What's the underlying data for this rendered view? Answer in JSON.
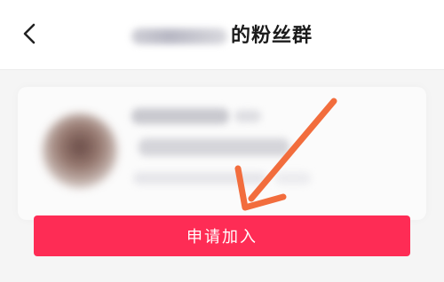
{
  "header": {
    "title_suffix": "的粉丝群",
    "back_icon": "chevron-left-icon"
  },
  "group_card": {
    "avatar_icon": "avatar-blurred"
  },
  "actions": {
    "join_label": "申请加入"
  },
  "colors": {
    "join_button": "#fe2c55",
    "annotation_arrow": "#f26d3d",
    "header_bg": "#ffffff",
    "page_bg": "#f5f5f5"
  }
}
